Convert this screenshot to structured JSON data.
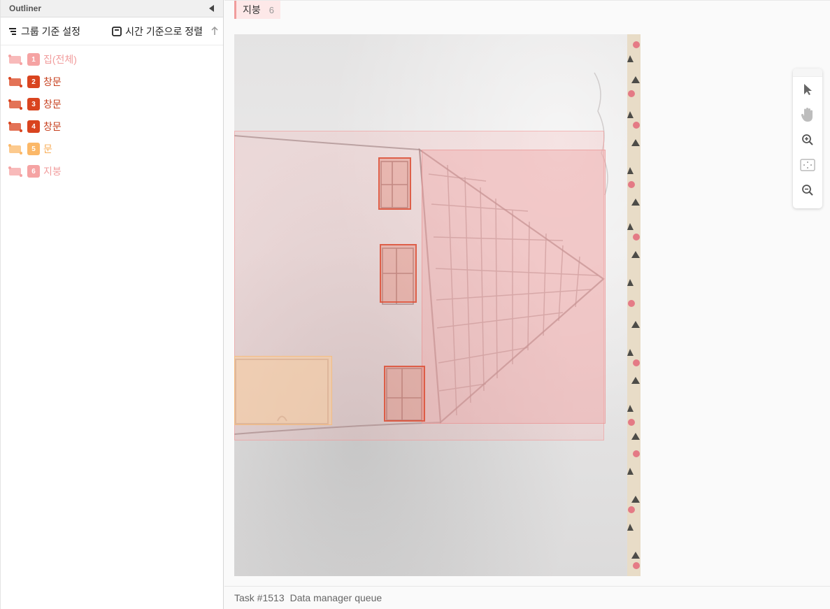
{
  "outliner": {
    "title": "Outliner",
    "group_button": "그룹 기준 설정",
    "sort_button": "시간 기준으로 정렬",
    "regions": [
      {
        "num": "1",
        "label": "집(전체)",
        "color": "#f5a3a3",
        "text_color": "#f19c9c",
        "icon": "rectangle-region-icon"
      },
      {
        "num": "2",
        "label": "창문",
        "color": "#d9441f",
        "text_color": "#c63d1b",
        "icon": "rectangle-region-icon"
      },
      {
        "num": "3",
        "label": "창문",
        "color": "#d9441f",
        "text_color": "#c63d1b",
        "icon": "rectangle-region-icon"
      },
      {
        "num": "4",
        "label": "창문",
        "color": "#d9441f",
        "text_color": "#c63d1b",
        "icon": "rectangle-region-icon"
      },
      {
        "num": "5",
        "label": "문",
        "color": "#fbb868",
        "text_color": "#f8ae59",
        "icon": "rectangle-region-icon"
      },
      {
        "num": "6",
        "label": "지붕",
        "color": "#f5a3a3",
        "text_color": "#f19c9c",
        "icon": "rectangle-region-icon"
      }
    ]
  },
  "label_chip": {
    "label": "지붕",
    "count": "6",
    "color": "#f19d9d"
  },
  "tools": [
    "pointer-icon",
    "pan-hand-icon",
    "zoom-in-icon",
    "fit-to-screen-icon",
    "zoom-out-icon"
  ],
  "footer": {
    "task": "Task #1513",
    "queue": "Data manager queue"
  }
}
